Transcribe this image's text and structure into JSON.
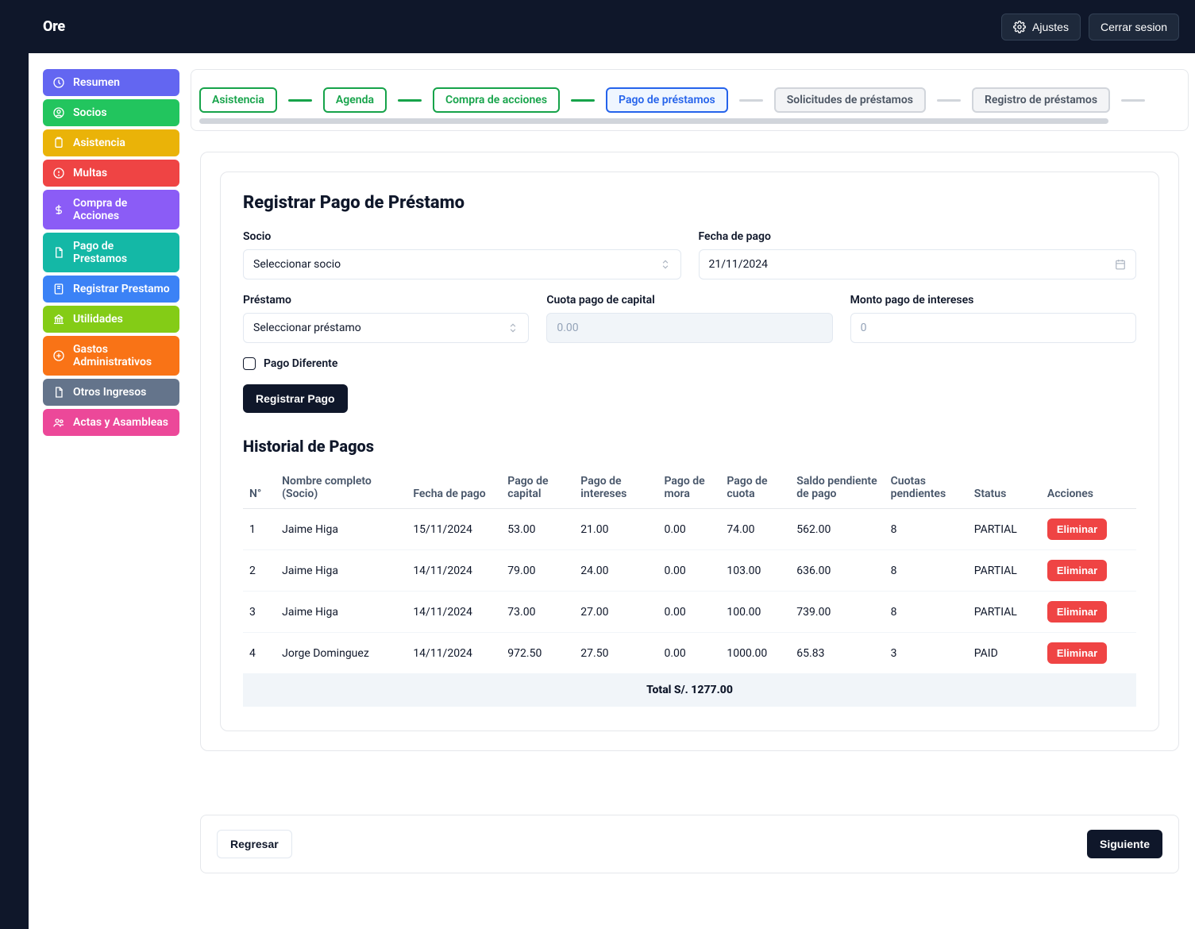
{
  "brand": "Ore",
  "header": {
    "settings_label": "Ajustes",
    "logout_label": "Cerrar sesion"
  },
  "sidebar": {
    "items": [
      {
        "id": "resumen",
        "label": "Resumen",
        "color": "c-indigo",
        "icon": "dashboard-icon"
      },
      {
        "id": "socios",
        "label": "Socios",
        "color": "c-green",
        "icon": "user-circle-icon"
      },
      {
        "id": "asistencia",
        "label": "Asistencia",
        "color": "c-amber",
        "icon": "clipboard-icon"
      },
      {
        "id": "multas",
        "label": "Multas",
        "color": "c-red",
        "icon": "alert-icon"
      },
      {
        "id": "compra-acciones",
        "label": "Compra de Acciones",
        "color": "c-violet",
        "icon": "dollar-icon"
      },
      {
        "id": "pago-prestamos",
        "label": "Pago de Prestamos",
        "color": "c-teal",
        "icon": "document-icon"
      },
      {
        "id": "registrar-prestamo",
        "label": "Registrar Prestamo",
        "color": "c-blue",
        "icon": "book-icon"
      },
      {
        "id": "utilidades",
        "label": "Utilidades",
        "color": "c-lime",
        "icon": "bank-icon"
      },
      {
        "id": "gastos-admin",
        "label": "Gastos Administrativos",
        "color": "c-orange",
        "icon": "plus-circle-icon"
      },
      {
        "id": "otros-ingresos",
        "label": "Otros Ingresos",
        "color": "c-slate",
        "icon": "document-icon"
      },
      {
        "id": "actas-asambleas",
        "label": "Actas y Asambleas",
        "color": "c-pink",
        "icon": "users-icon"
      }
    ]
  },
  "stepper": {
    "items": [
      {
        "label": "Asistencia",
        "state": "done"
      },
      {
        "label": "Agenda",
        "state": "done"
      },
      {
        "label": "Compra de acciones",
        "state": "done"
      },
      {
        "label": "Pago de préstamos",
        "state": "active"
      },
      {
        "label": "Solicitudes de préstamos",
        "state": "future"
      },
      {
        "label": "Registro de préstamos",
        "state": "future"
      }
    ]
  },
  "form": {
    "title": "Registrar Pago de Préstamo",
    "socio_label": "Socio",
    "socio_placeholder": "Seleccionar socio",
    "fecha_label": "Fecha de pago",
    "fecha_value": "21/11/2024",
    "prestamo_label": "Préstamo",
    "prestamo_placeholder": "Seleccionar préstamo",
    "cuota_label": "Cuota pago de capital",
    "cuota_placeholder": "0.00",
    "interes_label": "Monto pago de intereses",
    "interes_placeholder": "0",
    "pago_diff_label": "Pago Diferente",
    "submit_label": "Registrar Pago"
  },
  "history": {
    "title": "Historial de Pagos",
    "columns": {
      "n": "N°",
      "nombre": "Nombre completo (Socio)",
      "fecha": "Fecha de pago",
      "capital": "Pago de capital",
      "intereses": "Pago de intereses",
      "mora": "Pago de mora",
      "cuota": "Pago de cuota",
      "saldo": "Saldo pendiente de pago",
      "cuotas": "Cuotas pendientes",
      "status": "Status",
      "acciones": "Acciones"
    },
    "delete_label": "Eliminar",
    "rows": [
      {
        "n": "1",
        "nombre": "Jaime Higa",
        "fecha": "15/11/2024",
        "capital": "53.00",
        "intereses": "21.00",
        "mora": "0.00",
        "cuota": "74.00",
        "saldo": "562.00",
        "cuotas": "8",
        "status": "PARTIAL"
      },
      {
        "n": "2",
        "nombre": "Jaime Higa",
        "fecha": "14/11/2024",
        "capital": "79.00",
        "intereses": "24.00",
        "mora": "0.00",
        "cuota": "103.00",
        "saldo": "636.00",
        "cuotas": "8",
        "status": "PARTIAL"
      },
      {
        "n": "3",
        "nombre": "Jaime Higa",
        "fecha": "14/11/2024",
        "capital": "73.00",
        "intereses": "27.00",
        "mora": "0.00",
        "cuota": "100.00",
        "saldo": "739.00",
        "cuotas": "8",
        "status": "PARTIAL"
      },
      {
        "n": "4",
        "nombre": "Jorge Dominguez",
        "fecha": "14/11/2024",
        "capital": "972.50",
        "intereses": "27.50",
        "mora": "0.00",
        "cuota": "1000.00",
        "saldo": "65.83",
        "cuotas": "3",
        "status": "PAID"
      }
    ],
    "total_label": "Total  S/. 1277.00"
  },
  "footer": {
    "back_label": "Regresar",
    "next_label": "Siguiente"
  }
}
